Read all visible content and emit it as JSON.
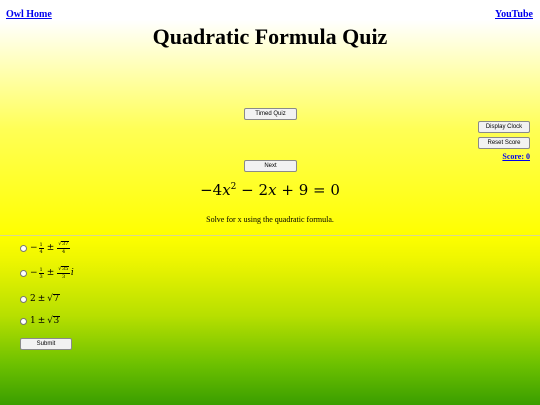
{
  "nav": {
    "home_label": "Owl Home",
    "youtube_label": "YouTube"
  },
  "page": {
    "title": "Quadratic Formula Quiz"
  },
  "controls": {
    "timed_quiz_label": "Timed Quiz",
    "next_label": "Next",
    "display_clock_label": "Display Clock",
    "reset_score_label": "Reset Score",
    "score_label": "Score: 0",
    "submit_label": "Submit"
  },
  "question": {
    "equation": {
      "a": "−4",
      "var": "x",
      "exp": "2",
      "b_sign": "−",
      "b": "2",
      "c_sign": "+",
      "c": "9",
      "eq": "=",
      "rhs": "0"
    },
    "instruction": "Solve for x using the quadratic formula."
  },
  "choices": [
    {
      "selected": false,
      "a_sign": "−",
      "a_num": "1",
      "a_den": "4",
      "pm": "±",
      "r_rad": "37",
      "r_den": "4",
      "imag": ""
    },
    {
      "selected": false,
      "a_sign": "−",
      "a_num": "1",
      "a_den": "3",
      "pm": "±",
      "r_rad": "35",
      "r_den": "3",
      "imag": "i"
    },
    {
      "selected": false,
      "whole": "2",
      "pm": "±",
      "r_rad": "7"
    },
    {
      "selected": false,
      "whole": "1",
      "pm": "±",
      "r_rad": "3"
    }
  ],
  "colors": {
    "link": "#0000ee",
    "background_top": "#ffff00",
    "background_bottom": "#3a9e00"
  }
}
